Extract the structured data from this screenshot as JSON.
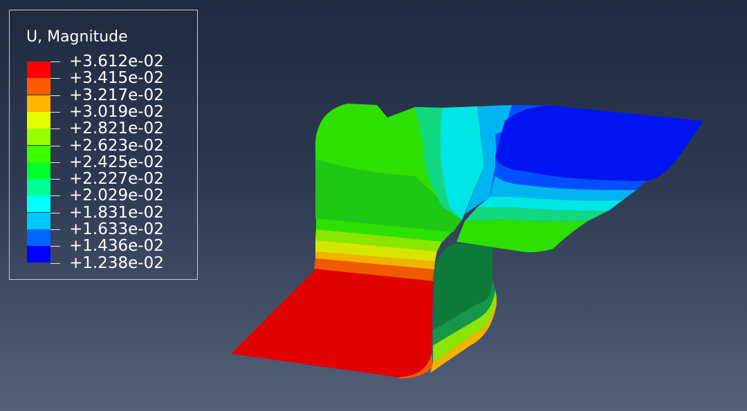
{
  "legend": {
    "title": "U, Magnitude",
    "values": [
      "+3.612e-02",
      "+3.415e-02",
      "+3.217e-02",
      "+3.019e-02",
      "+2.821e-02",
      "+2.623e-02",
      "+2.425e-02",
      "+2.227e-02",
      "+2.029e-02",
      "+1.831e-02",
      "+1.633e-02",
      "+1.436e-02",
      "+1.238e-02"
    ],
    "colors": [
      "#ff0000",
      "#ff5a00",
      "#ffb400",
      "#e6ff00",
      "#96ff00",
      "#3cff00",
      "#00ff28",
      "#00ff96",
      "#00ffff",
      "#00c8ff",
      "#0064ff",
      "#0000ff"
    ]
  },
  "model": {
    "colors": {
      "red": "#e00000",
      "orange": "#f05a00",
      "amber": "#f0b400",
      "yellow": "#d6e600",
      "lime": "#8ae600",
      "green": "#2ee000",
      "green_dark": "#1ec814",
      "mint": "#12d880",
      "cyan": "#00e6e6",
      "sky": "#00b4f0",
      "blue_mid": "#0050ff",
      "blue": "#0014f0",
      "wall_dark": "#0d7a3a",
      "wall_mid": "#15964a"
    }
  }
}
